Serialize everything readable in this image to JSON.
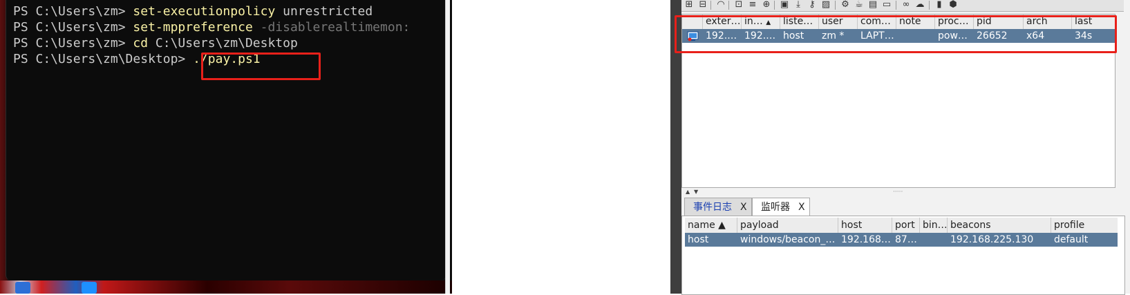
{
  "terminal": {
    "lines": [
      {
        "prompt": "PS C:\\Users\\zm> ",
        "cmd": "set-executionpolicy",
        "arg": " unrestricted",
        "param": ""
      },
      {
        "prompt": "PS C:\\Users\\zm> ",
        "cmd": "set-mppreference",
        "arg": " ",
        "param": "-disablerealtimemon:"
      },
      {
        "prompt": "PS C:\\Users\\zm> ",
        "cmd": "cd",
        "arg": " C:\\Users\\zm\\Desktop",
        "param": ""
      },
      {
        "prompt": "PS C:\\Users\\zm\\Desktop> ",
        "cmd": "./pay.ps1",
        "arg": "",
        "param": ""
      }
    ]
  },
  "cobalt_strike": {
    "toolbar_icons": [
      "add-icon",
      "remove-icon",
      "headphones-icon",
      "pivot-graph-icon",
      "list-icon",
      "target-icon",
      "credentials-icon",
      "download-icon",
      "key-icon",
      "screenshot-icon",
      "settings-icon",
      "coffee-icon",
      "document-icon",
      "console-icon",
      "link-icon",
      "cloud-icon",
      "book-icon",
      "cube-icon"
    ],
    "beacons": {
      "columns": [
        "exter…",
        "in…",
        "liste…",
        "user",
        "com…",
        "note",
        "proc…",
        "pid",
        "arch",
        "last"
      ],
      "sort_indicator": "▲",
      "rows": [
        {
          "external": "192.…",
          "internal": "192.…",
          "listener": "host",
          "user": "zm *",
          "computer": "LAPT…",
          "note": "",
          "process": "pow…",
          "pid": "26652",
          "arch": "x64",
          "last": "34s"
        }
      ]
    },
    "splitter_dots": "·····",
    "tabs": [
      {
        "label": "事件日志",
        "close": "X"
      },
      {
        "label": "监听器",
        "close": "X"
      }
    ],
    "listeners": {
      "columns": [
        "name ▲",
        "payload",
        "host",
        "port",
        "bin…",
        "beacons",
        "profile"
      ],
      "rows": [
        {
          "name": "host",
          "payload": "windows/beacon_…",
          "host": "192.168…",
          "port": "87…",
          "bind": "",
          "beacons": "192.168.225.130",
          "profile": "default"
        }
      ]
    },
    "colors": {
      "selected_row": "#5a7a9a",
      "highlight_box": "#e8201a",
      "terminal_bg": "#0c0c0c",
      "cmd_color": "#f9f1a5"
    }
  }
}
